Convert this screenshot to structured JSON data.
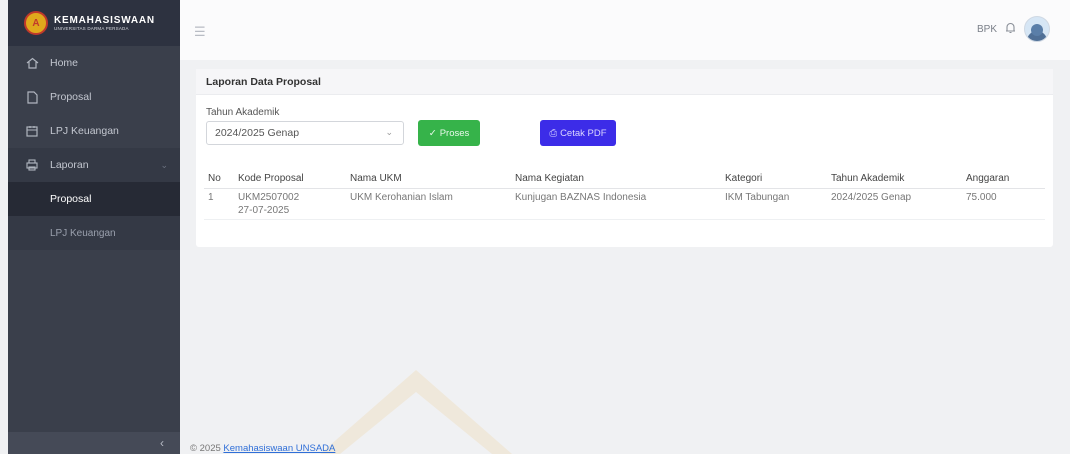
{
  "brand": {
    "title": "KEMAHASISWAAN",
    "subtitle": "UNIVERSITAS DARMA PERSADA",
    "logo_letter": "A"
  },
  "sidebar": {
    "items": [
      {
        "label": "Home",
        "icon": "home-icon"
      },
      {
        "label": "Proposal",
        "icon": "file-icon"
      },
      {
        "label": "LPJ Keuangan",
        "icon": "calendar-icon"
      },
      {
        "label": "Laporan",
        "icon": "printer-icon"
      }
    ],
    "subitems": [
      {
        "label": "Proposal"
      },
      {
        "label": "LPJ Keuangan"
      }
    ],
    "collapse_icon": "‹"
  },
  "topbar": {
    "user": "BPK"
  },
  "card": {
    "title": "Laporan Data Proposal",
    "form": {
      "label": "Tahun Akademik",
      "value": "2024/2025 Genap"
    },
    "btn_proses": "Proses",
    "btn_cetak": "Cetak PDF"
  },
  "table": {
    "headers": [
      "No",
      "Kode Proposal",
      "Nama UKM",
      "Nama Kegiatan",
      "Kategori",
      "Tahun Akademik",
      "Anggaran"
    ],
    "rows": [
      {
        "no": "1",
        "kode": "UKM2507002",
        "tanggal": "27-07-2025",
        "ukm": "UKM Kerohanian Islam",
        "kegiatan": "Kunjugan BAZNAS Indonesia",
        "kategori": "IKM Tabungan",
        "tahun": "2024/2025 Genap",
        "anggaran": "75.000"
      }
    ]
  },
  "footer": {
    "prefix": "© 2025",
    "link": "Kemahasiswaan UNSADA"
  },
  "colors": {
    "sidebar": "#3a3f4b",
    "proses": "#36b34a",
    "cetak": "#3c2ce8"
  }
}
